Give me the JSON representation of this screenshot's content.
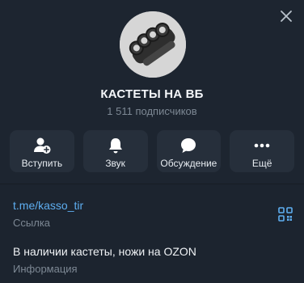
{
  "channel": {
    "title": "КАСТЕТЫ НА ВБ",
    "subscribers": "1 511 подписчиков"
  },
  "actions": [
    {
      "label": "Вступить",
      "icon": "add-user-icon"
    },
    {
      "label": "Звук",
      "icon": "bell-icon"
    },
    {
      "label": "Обсуждение",
      "icon": "chat-bubble-icon"
    },
    {
      "label": "Ещё",
      "icon": "more-dots-icon"
    }
  ],
  "info": {
    "link": {
      "value": "t.me/kasso_tir",
      "label": "Ссылка"
    },
    "description": {
      "value": "В наличии кастеты, ножи на OZON",
      "label": "Информация"
    }
  },
  "colors": {
    "background": "#1c242f",
    "button": "#262f3b",
    "link": "#5eaef0",
    "muted": "#7d8894"
  }
}
